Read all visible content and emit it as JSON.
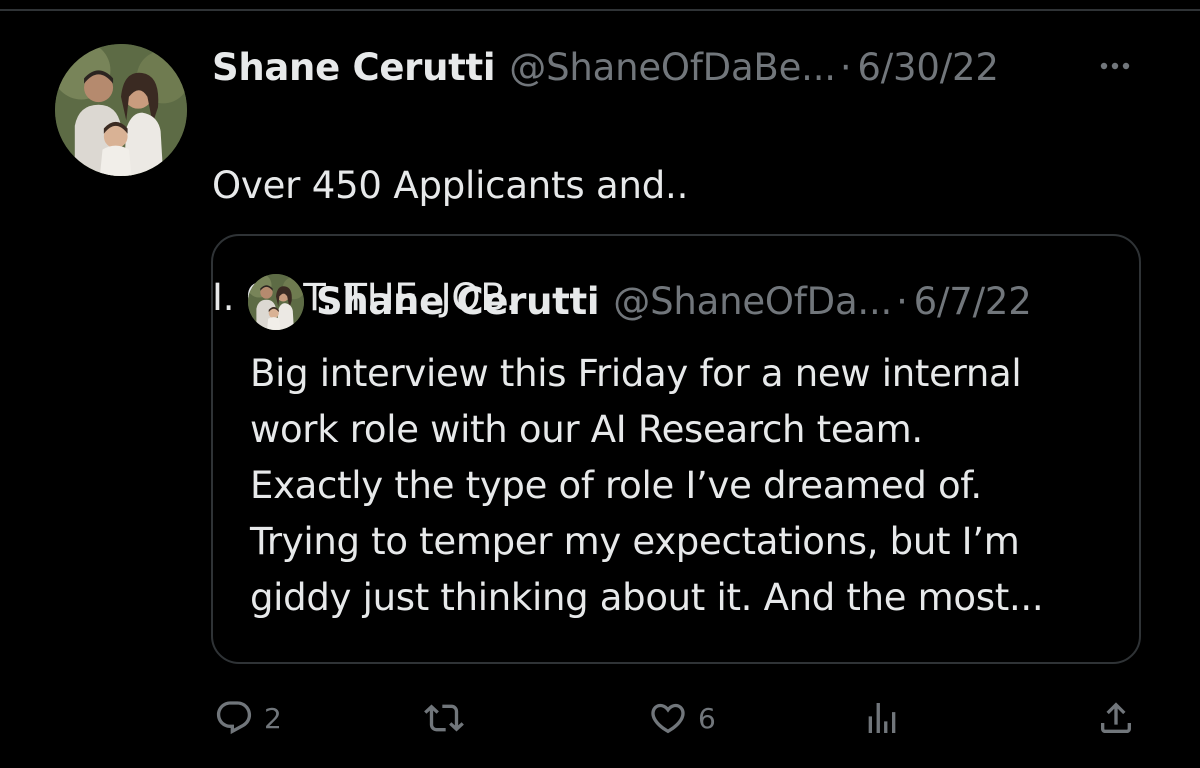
{
  "tweet": {
    "author_name": "Shane Cerutti",
    "handle": "@ShaneOfDaBe...",
    "separator": "·",
    "date": "6/30/22",
    "text_lines": [
      "Over 450 Applicants and..",
      "I. GOT. THE. JOB."
    ],
    "avatar_icon": "profile-photo-family",
    "more_icon": "more-horizontal-icon"
  },
  "quote": {
    "author_name": "Shane Cerutti",
    "handle": "@ShaneOfDa...",
    "separator": "·",
    "date": "6/7/22",
    "text_lines": [
      "Big interview this Friday for a new internal",
      "work role with our AI Research team.",
      "Exactly the type of role I’ve dreamed of.",
      "Trying to temper my expectations, but I’m",
      "giddy just thinking about it. And the most..."
    ]
  },
  "actions": {
    "reply": {
      "icon": "reply-icon",
      "count": "2"
    },
    "retweet": {
      "icon": "retweet-icon",
      "count": ""
    },
    "like": {
      "icon": "heart-icon",
      "count": "6"
    },
    "views": {
      "icon": "views-chart-icon",
      "count": ""
    },
    "share": {
      "icon": "share-icon",
      "count": ""
    }
  },
  "colors": {
    "background": "#000000",
    "text_primary": "#e7e9ea",
    "text_secondary": "#71767b",
    "border": "#2f3336"
  }
}
